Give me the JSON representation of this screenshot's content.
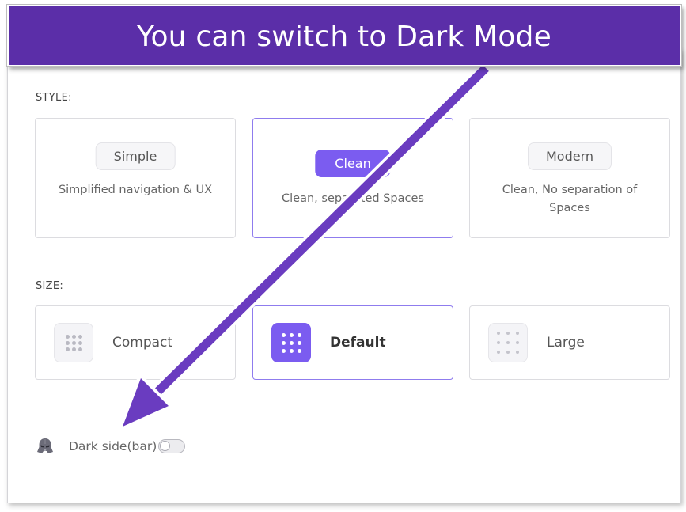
{
  "banner": {
    "title": "You can switch to Dark Mode"
  },
  "style_section": {
    "label": "STYLE:",
    "options": [
      {
        "name": "Simple",
        "description": "Simplified navigation & UX",
        "selected": false
      },
      {
        "name": "Clean",
        "description": "Clean, separated Spaces",
        "selected": true
      },
      {
        "name": "Modern",
        "description": "Clean, No separation of Spaces",
        "selected": false
      }
    ]
  },
  "size_section": {
    "label": "SIZE:",
    "options": [
      {
        "name": "Compact",
        "selected": false
      },
      {
        "name": "Default",
        "selected": true
      },
      {
        "name": "Large",
        "selected": false
      }
    ]
  },
  "dark_mode": {
    "label": "Dark side(bar)",
    "enabled": false
  },
  "colors": {
    "banner": "#5b2ea8",
    "accent": "#7b5cf0",
    "arrow": "#6a3cc0"
  }
}
